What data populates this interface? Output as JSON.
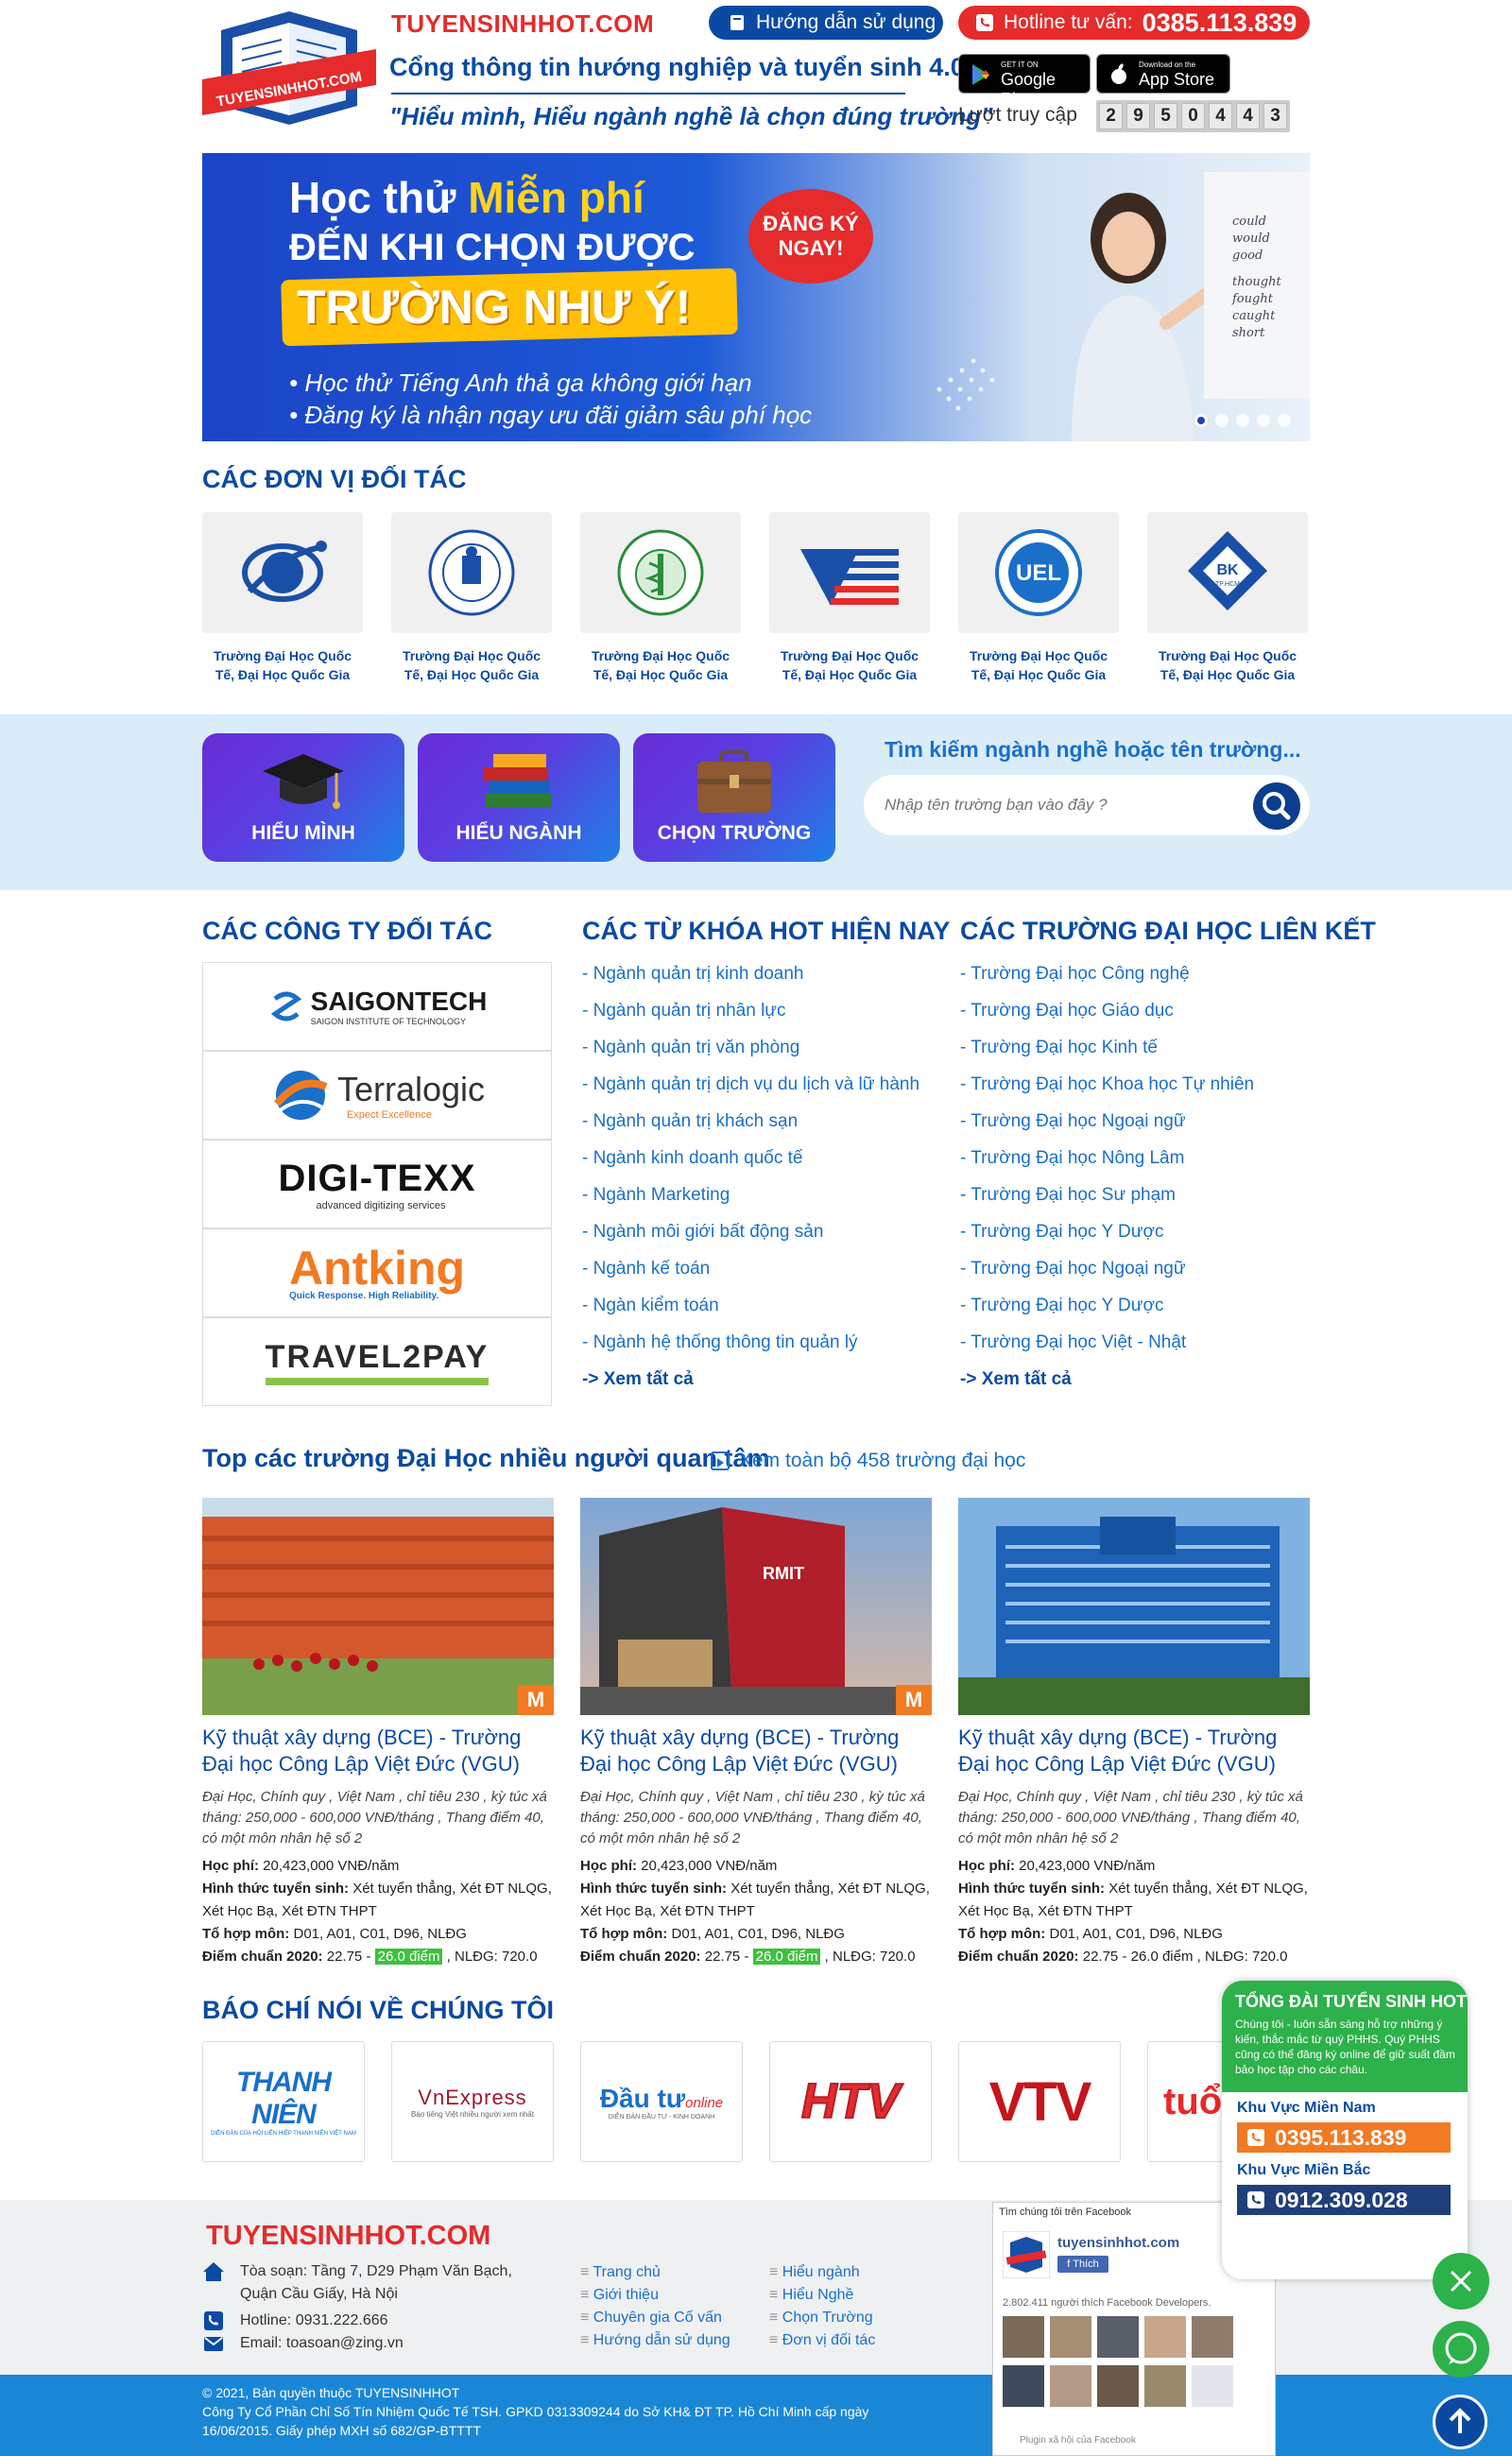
{
  "header": {
    "brand": "TUYENSINHHOT.COM",
    "tagline": "Cổng thông tin hướng nghiệp và tuyển sinh 4.0",
    "motto": "\"Hiểu mình, Hiểu ngành nghề là chọn đúng trường\"",
    "guide_button": "Hướng dẫn sử dụng",
    "hotline_label": "Hotline tư vấn:",
    "hotline_number": "0385.113.839",
    "google_play_small": "GET IT ON",
    "google_play": "Google Play",
    "app_store_small": "Download on the",
    "app_store": "App Store",
    "visits_label": "Lượt truy cập",
    "visit_digits": [
      "2",
      "9",
      "5",
      "0",
      "4",
      "4",
      "3"
    ],
    "logo_text": "TUYENSINHHOT.COM"
  },
  "banner": {
    "line1_prefix": "Học thử ",
    "line1_highlight": "Miễn phí",
    "line2": "ĐẾN KHI CHỌN ĐƯỢC",
    "line3": "TRƯỜNG NHƯ Ý!",
    "bubble": "ĐĂNG KÝ NGAY!",
    "bullet1": "• Học thử Tiếng Anh thả ga không giới hạn",
    "bullet2": "• Đăng ký là nhận ngay ưu đãi giảm sâu phí học",
    "board_words": [
      "could",
      "would",
      "good",
      "thought",
      "fought",
      "caught",
      "short"
    ]
  },
  "partners": {
    "title": "CÁC ĐƠN VỊ ĐỐI TÁC",
    "items": [
      {
        "caption": "Trường Đại Học Quốc Tế, Đại Học Quốc Gia",
        "logo": "intl-university-logo"
      },
      {
        "caption": "Trường Đại Học Quốc Tế, Đại Học Quốc Gia",
        "logo": "hcm-intl-university-seal"
      },
      {
        "caption": "Trường Đại Học Quốc Tế, Đại Học Quốc Gia",
        "logo": "medical-university-seal"
      },
      {
        "caption": "Trường Đại Học Quốc Tế, Đại Học Quốc Gia",
        "logo": "flag-stripes-logo"
      },
      {
        "caption": "Trường Đại Học Quốc Tế, Đại Học Quốc Gia",
        "logo": "uel-logo",
        "logo_text": "UEL"
      },
      {
        "caption": "Trường Đại Học Quốc Tế, Đại Học Quốc Gia",
        "logo": "bk-logo",
        "logo_text": "BK",
        "logo_sub": "TP.HCM"
      }
    ]
  },
  "quick_actions": [
    {
      "label": "HIỂU MÌNH",
      "icon": "graduation-cap-icon"
    },
    {
      "label": "HIỂU NGÀNH",
      "icon": "books-icon"
    },
    {
      "label": "CHỌN TRƯỜNG",
      "icon": "briefcase-icon"
    }
  ],
  "search": {
    "label": "Tìm kiếm ngành nghề hoặc tên trường...",
    "placeholder": "Nhập tên trường bạn vào đây ?"
  },
  "companies": {
    "title": "CÁC CÔNG TY ĐỐI TÁC",
    "items": [
      {
        "name": "SAIGONTECH",
        "sub": "SAIGON INSTITUTE OF TECHNOLOGY",
        "color": "#1a1a1a"
      },
      {
        "name": "Terralogic",
        "sub": "Expect Excellence",
        "color": "#333333"
      },
      {
        "name": "DIGI-TEXX",
        "sub": "advanced digitizing services",
        "color": "#111111"
      },
      {
        "name": "Antking",
        "sub": "Quick Response. High Reliability.",
        "color": "#f27a22"
      },
      {
        "name": "TRAVEL2PAY",
        "sub": "",
        "color": "#2b2b2b"
      }
    ]
  },
  "keywords": {
    "title": "CÁC TỪ KHÓA HOT HIỆN NAY",
    "items": [
      "- Ngành quản trị kinh doanh",
      "- Ngành quản trị nhân lực",
      "- Ngành quản trị văn phòng",
      "- Ngành quản trị dịch vụ du lịch và lữ hành",
      "- Ngành quản trị khách sạn",
      "- Ngành kinh doanh quốc tế",
      "- Ngành Marketing",
      "- Ngành môi giới bất động sản",
      "- Ngành kế toán",
      "- Ngàn kiểm toán",
      "- Ngành hệ thống thông tin quản lý"
    ],
    "more": "-> Xem tất cả"
  },
  "schools": {
    "title": "CÁC TRƯỜNG ĐẠI HỌC LIÊN KẾT",
    "items": [
      "- Trường Đại học Công nghệ",
      "- Trường Đại học Giáo dục",
      "- Trường Đại học Kinh tế",
      "- Trường Đại học Khoa học Tự nhiên",
      "- Trường Đại học Ngoại ngữ",
      "- Trường Đại học Nông Lâm",
      "- Trường Đại học Sư phạm",
      "- Trường Đại học Y Dược",
      "- Trường Đại học Ngoại ngữ",
      "- Trường Đại học Y Dược",
      "- Trường Đại học Việt - Nhật"
    ],
    "more": "-> Xem tất cả"
  },
  "top": {
    "title": "Top các trường Đại Học nhiều người quan tâm",
    "view_all": "Xem toàn bộ 458 trường đại học",
    "cards": [
      {
        "title": "Kỹ thuật xây dựng (BCE) - Trường Đại học Công Lập Việt Đức (VGU)",
        "desc": "Đại Học, Chính quy , Việt Nam , chỉ tiêu 230 , kỳ túc xá tháng: 250,000 - 600,000 VNĐ/tháng , Thang điểm 40, có một môn nhân hệ số 2",
        "fee_label": "Học phí:",
        "fee": " 20,423,000 VNĐ/năm",
        "method_label": "Hình thức tuyển sinh:",
        "method": " Xét tuyển thẳng, Xét ĐT NLQG, Xét Học Bạ, Xét ĐTN THPT",
        "combo_label": "Tổ hợp môn:",
        "combo": " D01, A01, C01, D96, NLĐG",
        "score_label": "Điểm chuẩn 2020:",
        "score_a": " 22.75 - ",
        "score_hl": "26.0 điểm",
        "score_b": " , NLĐG: 720.0",
        "badge": "M",
        "img": "orange-building-photo"
      },
      {
        "title": "Kỹ thuật xây dựng (BCE) - Trường Đại học Công Lập Việt Đức (VGU)",
        "desc": "Đại Học, Chính quy , Việt Nam , chỉ tiêu 230 , kỳ túc xá tháng: 250,000 - 600,000 VNĐ/tháng , Thang điểm 40, có một môn nhân hệ số 2",
        "fee_label": "Học phí:",
        "fee": " 20,423,000 VNĐ/năm",
        "method_label": "Hình thức tuyển sinh:",
        "method": " Xét tuyển thẳng, Xét ĐT NLQG, Xét Học Bạ, Xét ĐTN THPT",
        "combo_label": "Tổ hợp môn:",
        "combo": " D01, A01, C01, D96, NLĐG",
        "score_label": "Điểm chuẩn 2020:",
        "score_a": " 22.75 - ",
        "score_hl": "26.0 điểm",
        "score_b": " , NLĐG: 720.0",
        "badge": "M",
        "img": "rmit-building-photo",
        "img_text": "RMIT"
      },
      {
        "title": "Kỹ thuật xây dựng (BCE) - Trường Đại học Công Lập Việt Đức (VGU)",
        "desc": "Đại Học, Chính quy , Việt Nam , chỉ tiêu 230 , kỳ túc xá tháng: 250,000 - 600,000 VNĐ/tháng , Thang điểm 40, có một môn nhân hệ số 2",
        "fee_label": "Học phí:",
        "fee": " 20,423,000 VNĐ/năm",
        "method_label": "Hình thức tuyển sinh:",
        "method": " Xét tuyển thẳng, Xét ĐT NLQG, Xét Học Bạ, Xét ĐTN THPT",
        "combo_label": "Tổ hợp môn:",
        "combo": " D01, A01, C01, D96, NLĐG",
        "score_label": "Điểm chuẩn 2020:",
        "score_plain": " 22.75 - 26.0 điểm , NLĐG: 720.0",
        "img": "blue-building-photo"
      }
    ]
  },
  "press": {
    "title": "BÁO CHÍ NÓI VỀ CHÚNG TÔI",
    "items": [
      {
        "name": "THANH NIÊN",
        "sub": "DIỄN ĐÀN CỦA HỘI LIÊN HIỆP THANH NIÊN VIỆT NAM"
      },
      {
        "name": "VnExpress",
        "sub": "Báo tiếng Việt nhiều người xem nhất"
      },
      {
        "name": "Đầu tư",
        "sub": "DIỄN ĐÀN ĐẦU TƯ - KINH DOANH",
        "extra": "online"
      },
      {
        "name": "HTV"
      },
      {
        "name": "VTV"
      },
      {
        "name": "tuổi"
      }
    ]
  },
  "footer": {
    "brand": "TUYENSINHHOT.COM",
    "address": "Tòa soạn: Tầng 7, D29 Phạm Văn Bạch, Quận Cầu Giấy, Hà Nội",
    "hotline": "Hotline: 0931.222.666",
    "email": "Email: toasoan@zing.vn",
    "links_col1": [
      "Trang chủ",
      "Giới thiệu",
      "Chuyên gia Cố vấn",
      "Hướng dẫn sử dụng"
    ],
    "links_col2": [
      "Hiểu ngành",
      "Hiểu Nghề",
      "Chọn Trường",
      "Đơn vị đối tác"
    ],
    "copy1": "© 2021, Bản quyền thuộc TUYENSINHHOT",
    "copy2": "Công Ty Cổ Phần Chỉ Số Tín Nhiệm Quốc Tế TSH. GPKD 0313309244 do Sở KH& ĐT TP. Hồ Chí Minh cấp ngày",
    "copy3": "16/06/2015. Giấy phép MXH số 682/GP-BTTTT"
  },
  "hotline_panel": {
    "title": "TỔNG ĐÀI TUYỂN SINH HOT",
    "desc": "Chúng tôi - luôn sẵn sàng hỗ trợ những ý kiến, thắc mắc từ quý PHHS. Quý PHHS cũng có thể đăng ký online để giữ suất đầm bảo học tập cho các châu.",
    "south_label": "Khu Vực Miền Nam",
    "south_number": "0395.113.839",
    "north_label": "Khu Vực Miền Bắc",
    "north_number": "0912.309.028"
  },
  "facebook": {
    "header": "Tìm chúng tôi trên Facebook",
    "page_name": "tuyensinhhot.com",
    "like": "Thích",
    "count": "2.802.411 người thích Facebook Developers.",
    "footer": "Plugin xã hội của Facebook"
  },
  "colors": {
    "primary": "#0b4aa2",
    "accent": "#e52b2b",
    "link": "#1a6fc9",
    "band": "#d9ecf8",
    "green": "#2db14a"
  }
}
